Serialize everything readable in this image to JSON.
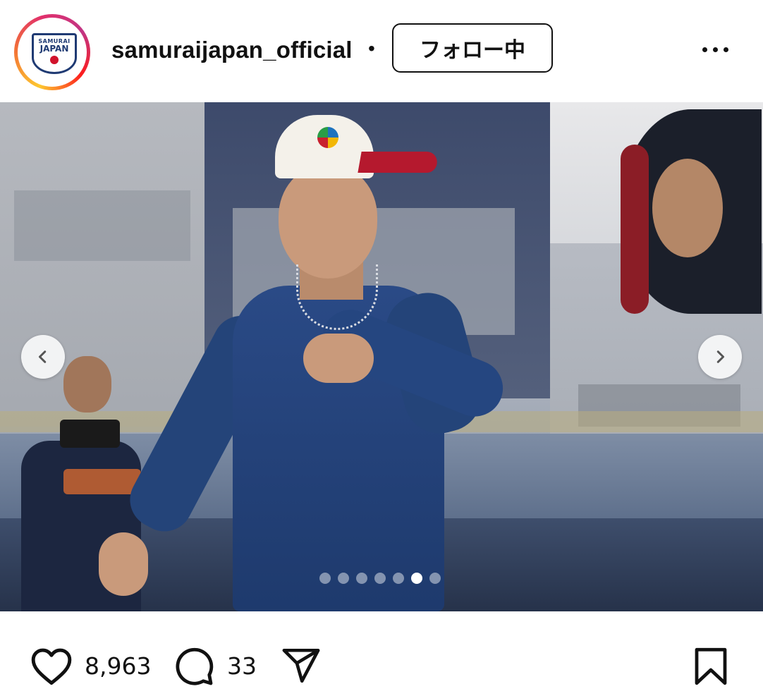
{
  "header": {
    "username": "samuraijapan_official",
    "separator": "•",
    "follow_label": "フォロー中",
    "avatar_logo_top": "SAMURAI",
    "avatar_logo_main": "JAPAN",
    "more_icon": "more-horizontal-icon"
  },
  "post": {
    "image_description": "Player in navy long-sleeve shirt and white WBC cap on baseball field",
    "carousel": {
      "prev_icon": "chevron-left-icon",
      "next_icon": "chevron-right-icon",
      "total_slides": 7,
      "active_index": 5
    }
  },
  "actions": {
    "like_icon": "heart-icon",
    "like_count": "8,963",
    "comment_icon": "comment-icon",
    "comment_count": "33",
    "share_icon": "send-icon",
    "save_icon": "bookmark-icon"
  },
  "colors": {
    "story_ring": [
      "#fdc830",
      "#f37335",
      "#e1306c",
      "#c13584"
    ],
    "brand_navy": "#1f3a73",
    "text": "#111111"
  }
}
